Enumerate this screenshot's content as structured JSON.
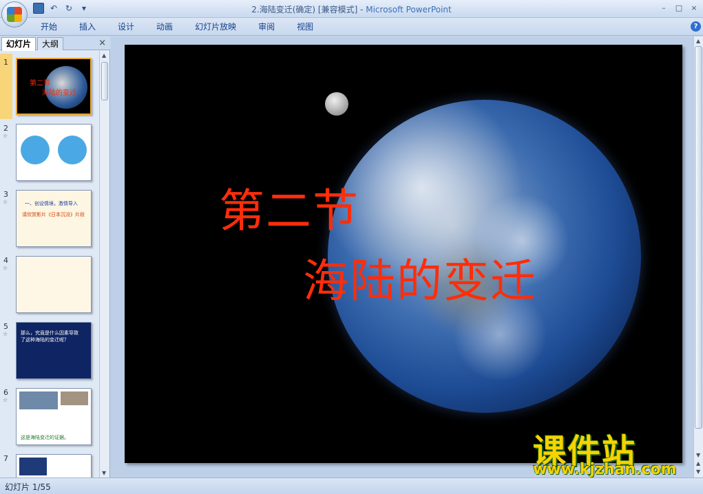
{
  "window": {
    "title_doc": "2.海陆变迁(确定) [兼容模式]",
    "title_sep": " - ",
    "title_app": "Microsoft PowerPoint",
    "controls": {
      "minimize": "–",
      "maximize": "□",
      "close": "×"
    }
  },
  "qat": {
    "save": "save-icon",
    "undo": "↶",
    "redo": "↻",
    "more": "▾"
  },
  "ribbon": {
    "tabs": [
      "开始",
      "插入",
      "设计",
      "动画",
      "幻灯片放映",
      "审阅",
      "视图"
    ],
    "help": "?"
  },
  "panel": {
    "tabs": [
      "幻灯片",
      "大纲"
    ],
    "close": "×"
  },
  "thumbnails": [
    {
      "number": "1",
      "mini_title1": "第二节",
      "mini_title2": "海陆的变迁"
    },
    {
      "number": "2"
    },
    {
      "number": "3",
      "mini_text1": "一、创设情境，激情导入",
      "mini_text2": "请欣赏影片《日本沉没》片段"
    },
    {
      "number": "4"
    },
    {
      "number": "5",
      "mini_text1": "那么，究竟是什么因素导致",
      "mini_text2": "了这种海陆的变迁呢？"
    },
    {
      "number": "6",
      "mini_text1": "这是海陆变迁的证据。"
    },
    {
      "number": "7"
    }
  ],
  "slide": {
    "title_line1": "第二节",
    "title_line2": "海陆的变迁"
  },
  "watermark": {
    "title": "课件站",
    "url": "www.kjzhan.com"
  },
  "status": {
    "slide_indicator": "幻灯片 1/55"
  }
}
